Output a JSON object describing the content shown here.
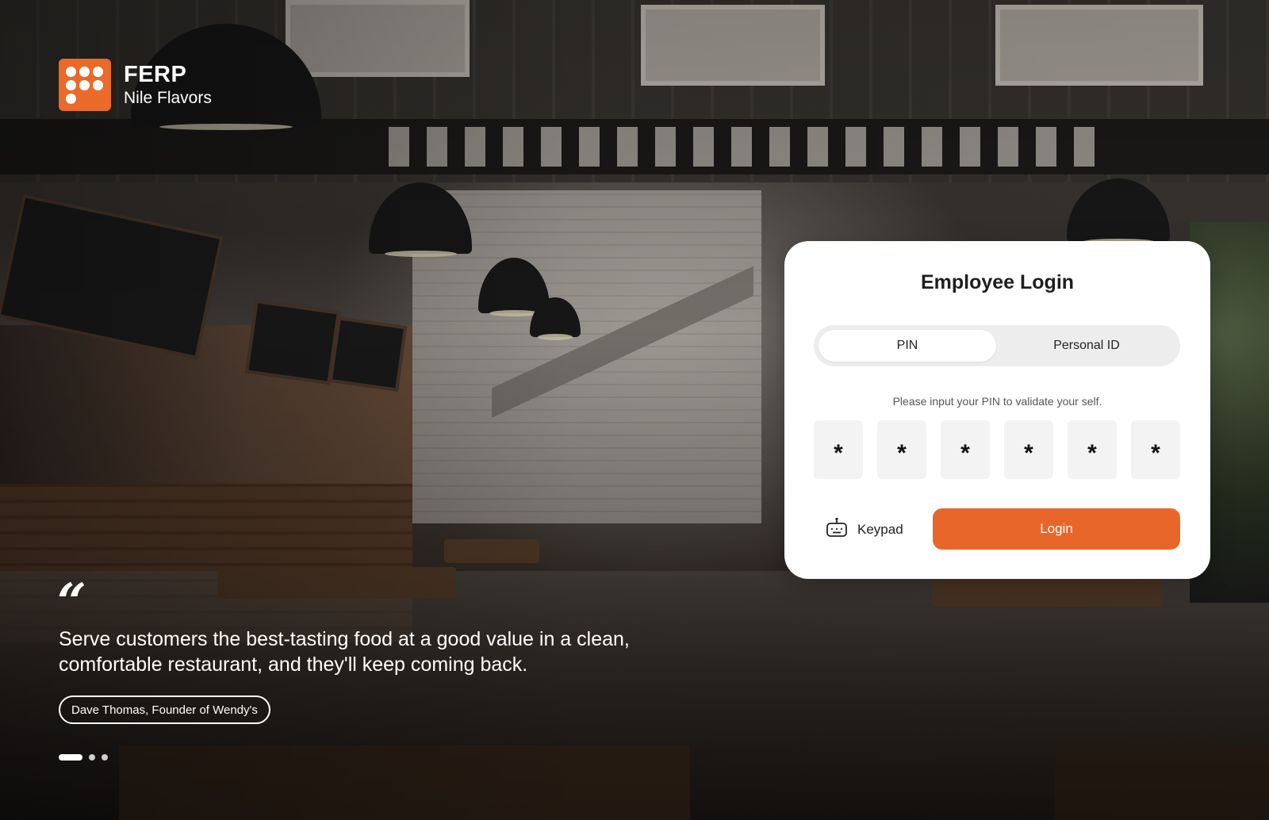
{
  "brand": {
    "logo_icon": "dots-grid-logo-icon",
    "name": "FERP",
    "subtitle": "Nile Flavors",
    "accent_color": "#ea6a2a"
  },
  "testimonial": {
    "quote_mark": "“",
    "text": "Serve customers the best-tasting food at a good value in a clean, comfortable restaurant, and they'll keep coming back.",
    "author": "Dave Thomas, Founder of Wendy's",
    "pager": {
      "total": 3,
      "active": 1
    }
  },
  "login": {
    "title": "Employee Login",
    "tabs": [
      {
        "label": "PIN",
        "active": true
      },
      {
        "label": "Personal ID",
        "active": false
      }
    ],
    "hint": "Please input your PIN to validate your self.",
    "pin_digits": [
      "*",
      "*",
      "*",
      "*",
      "*",
      "*"
    ],
    "keypad_label": "Keypad",
    "keypad_icon": "keyboard-icon",
    "login_label": "Login",
    "login_color": "#e8662a"
  }
}
